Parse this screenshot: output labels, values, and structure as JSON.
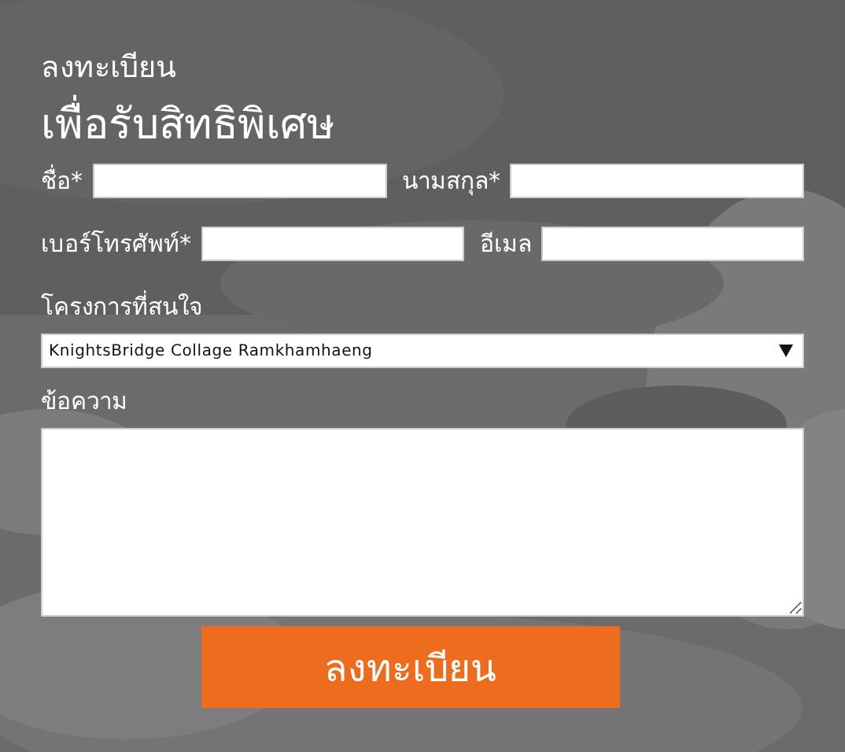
{
  "heading": {
    "line_1": "ลงทะเบียน",
    "line_2": "เพื่อรับสิทธิพิเศษ"
  },
  "rows": [
    {
      "fields": [
        {
          "label": "ชื่อ*"
        },
        {
          "label": "นามสกุล*"
        }
      ]
    },
    {
      "fields": [
        {
          "label": "เบอร์โทรศัพท์*"
        },
        {
          "label": "อีเมล"
        }
      ]
    }
  ],
  "interest": {
    "label": "โครงการที่สนใจ",
    "value": "KnightsBridge Collage Ramkhamhaeng"
  },
  "message": {
    "label": "ข้อความ"
  },
  "submit_button": "ลงทะเบียน"
}
